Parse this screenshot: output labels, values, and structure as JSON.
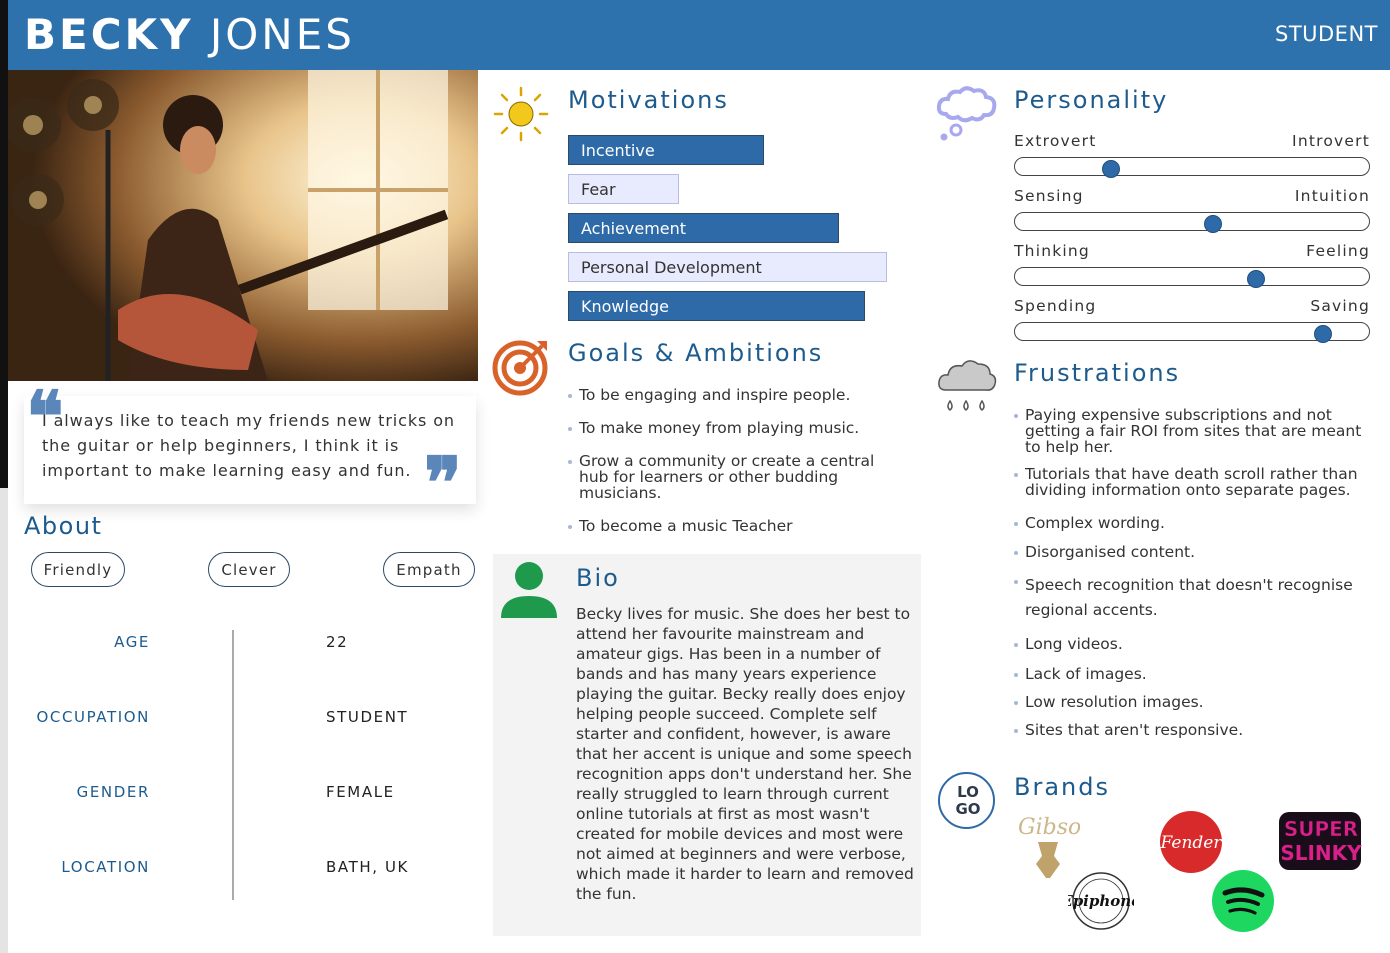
{
  "header": {
    "first_name": "BECKY",
    "last_name": "JONES",
    "role": "STUDENT"
  },
  "quote": {
    "text": "I always like to teach my friends new tricks on the guitar or help beginners, I think it is important to make learning easy and fun."
  },
  "about": {
    "title": "About",
    "traits": [
      "Friendly",
      "Clever",
      "Empath"
    ],
    "info": [
      {
        "label": "AGE",
        "value": "22"
      },
      {
        "label": "OCCUPATION",
        "value": "STUDENT"
      },
      {
        "label": "GENDER",
        "value": "FEMALE"
      },
      {
        "label": "LOCATION",
        "value": "BATH, UK"
      }
    ]
  },
  "motivations": {
    "title": "Motivations",
    "items": [
      {
        "label": "Incentive",
        "level": "high"
      },
      {
        "label": "Fear",
        "level": "low"
      },
      {
        "label": "Achievement",
        "level": "high"
      },
      {
        "label": "Personal Development",
        "level": "low"
      },
      {
        "label": "Knowledge",
        "level": "high"
      }
    ]
  },
  "goals": {
    "title": "Goals & Ambitions",
    "items": [
      "To be engaging and inspire people.",
      "To make money from playing music.",
      "Grow a community or create a central hub for learners or other budding musicians.",
      "To become a music Teacher"
    ]
  },
  "bio": {
    "title": "Bio",
    "text": "Becky lives for music. She does her best to attend her favourite mainstream and amateur gigs. Has been in a number of bands and has many years experience playing the guitar. Becky really does enjoy helping people succeed. Complete self starter and confident, however, is aware that her accent is unique and some speech recognition apps don't understand her. She really struggled to learn through current online tutorials at first as most wasn't created for mobile devices and most were not aimed at beginners and were verbose, which made it harder to learn and removed the fun."
  },
  "personality": {
    "title": "Personality",
    "traits": [
      {
        "left": "Extrovert",
        "right": "Introvert",
        "value": 0.27
      },
      {
        "left": "Sensing",
        "right": "Intuition",
        "value": 0.56
      },
      {
        "left": "Thinking",
        "right": "Feeling",
        "value": 0.68
      },
      {
        "left": "Spending",
        "right": "Saving",
        "value": 0.87
      }
    ]
  },
  "frustrations": {
    "title": "Frustrations",
    "items": [
      "Paying expensive subscriptions and not getting a fair ROI from sites that are meant to help her.",
      "Tutorials that have death scroll rather than dividing information onto separate pages.",
      "Complex wording.",
      "Disorganised content.",
      "Speech recognition that doesn't recognise regional accents.",
      "Long videos.",
      "Lack of images.",
      "Low resolution images.",
      "Sites that aren't responsive."
    ]
  },
  "brands": {
    "title": "Brands",
    "logo_placeholder": "LO GO",
    "items": [
      "Gibson",
      "Fender",
      "Super Slinky",
      "Epiphone",
      "Spotify"
    ]
  },
  "colors": {
    "header": "#2e72ad",
    "accent": "#2e6aa8",
    "light_bar": "#e8ebfd",
    "goals_icon": "#d9622b",
    "bio_icon": "#1f9a4c",
    "sun_icon": "#f2c81d"
  }
}
